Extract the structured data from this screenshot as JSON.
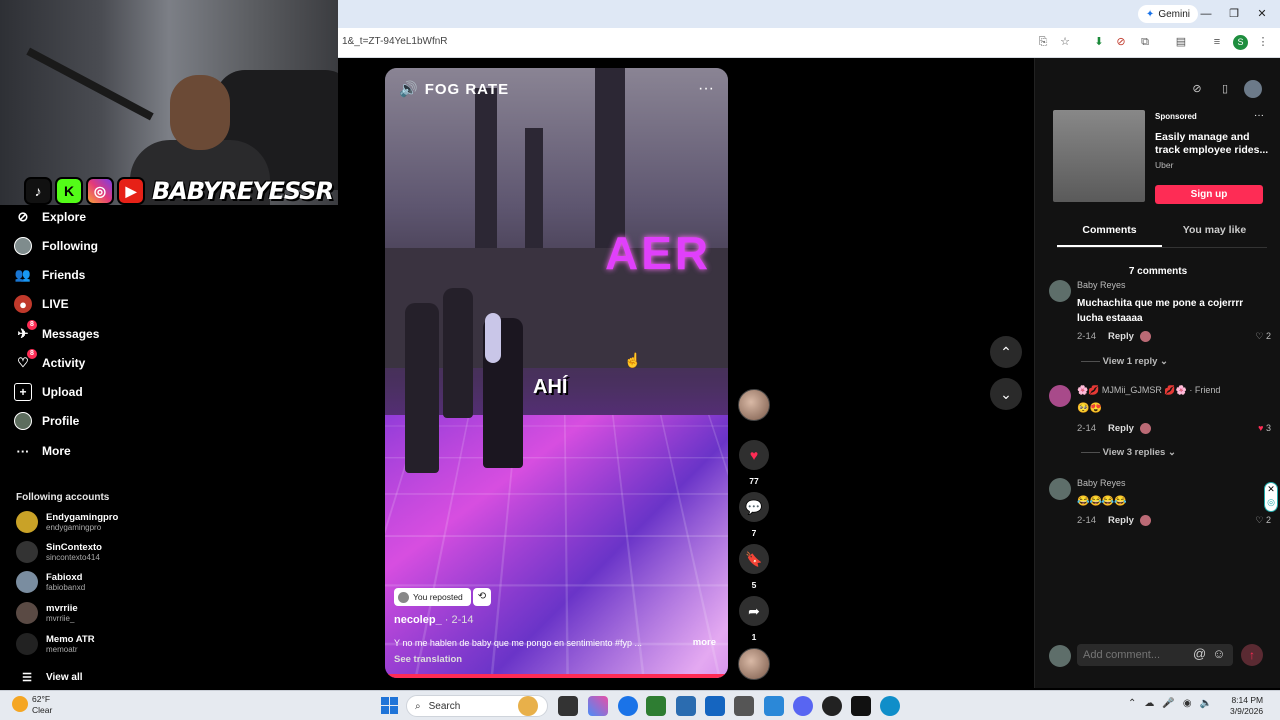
{
  "browser": {
    "url": "1&_t=ZT-94YeL1bWfnR",
    "gemini_label": "Gemini",
    "profile_initial": "S"
  },
  "stream_overlay": {
    "brand": "BABYREYESSR",
    "social_icons": [
      "tiktok-icon",
      "kick-icon",
      "instagram-icon",
      "youtube-icon"
    ]
  },
  "nav": {
    "items": [
      {
        "label": "Explore",
        "icon": "compass-icon"
      },
      {
        "label": "Following",
        "icon": "following-avatar-icon"
      },
      {
        "label": "Friends",
        "icon": "friends-icon"
      },
      {
        "label": "LIVE",
        "icon": "live-icon"
      },
      {
        "label": "Messages",
        "icon": "messages-icon",
        "badge": "8"
      },
      {
        "label": "Activity",
        "icon": "activity-icon",
        "badge": "8"
      },
      {
        "label": "Upload",
        "icon": "upload-icon"
      },
      {
        "label": "Profile",
        "icon": "profile-avatar-icon"
      },
      {
        "label": "More",
        "icon": "more-icon"
      }
    ],
    "following_title": "Following accounts",
    "accounts": [
      {
        "name": "Endygamingpro",
        "handle": "endygamingpro"
      },
      {
        "name": "SinContexto",
        "handle": "sincontexto414"
      },
      {
        "name": "Fabioxd",
        "handle": "fabiobanxd"
      },
      {
        "name": "mvrriie",
        "handle": "mvrriie_"
      },
      {
        "name": "Memo ATR",
        "handle": "memoatr"
      }
    ],
    "view_all": "View all"
  },
  "video": {
    "channel_tag": "FOG RATE",
    "overlay_text": "AHÍ",
    "neon_sign": "AER",
    "reposted_label": "You reposted",
    "username": "necolep_",
    "date": "· 2-14",
    "description": "Y no me hablen de baby que me pongo en sentimiento #fyp ...",
    "more_label": "more",
    "translation_label": "See translation",
    "progress": 1.0
  },
  "actions": {
    "likes": "77",
    "comments": "7",
    "saves": "5",
    "shares": "1"
  },
  "sidebar_right": {
    "sponsored_label": "Sponsored",
    "ad_title": "Easily manage and track employee rides...",
    "ad_brand": "Uber",
    "signup_label": "Sign up",
    "tabs": [
      "Comments",
      "You may like"
    ],
    "comment_count": "7 comments",
    "comments": [
      {
        "name": "Baby Reyes",
        "text": "Muchachita que me pone a cojerrrr lucha estaaaa",
        "date": "2-14",
        "reply": "Reply",
        "likes": "2",
        "liked": false,
        "view_replies": "View 1 reply"
      },
      {
        "name": "🌸💋 MJMii_GJMSR 💋🌸 · Friend",
        "text": "🥺😍",
        "date": "2-14",
        "reply": "Reply",
        "likes": "3",
        "liked": true,
        "view_replies": "View 3 replies"
      },
      {
        "name": "Baby Reyes",
        "text": "😂😂😂😂",
        "date": "2-14",
        "reply": "Reply",
        "likes": "2",
        "liked": false,
        "view_replies": ""
      }
    ],
    "add_comment_placeholder": "Add comment..."
  },
  "taskbar": {
    "temperature": "62°F",
    "weather": "Clear",
    "search_placeholder": "Search",
    "time": "8:14 PM",
    "date": "3/9/2026"
  },
  "colors": {
    "accent": "#fe2c55",
    "background": "#000000",
    "panel": "#121212"
  }
}
